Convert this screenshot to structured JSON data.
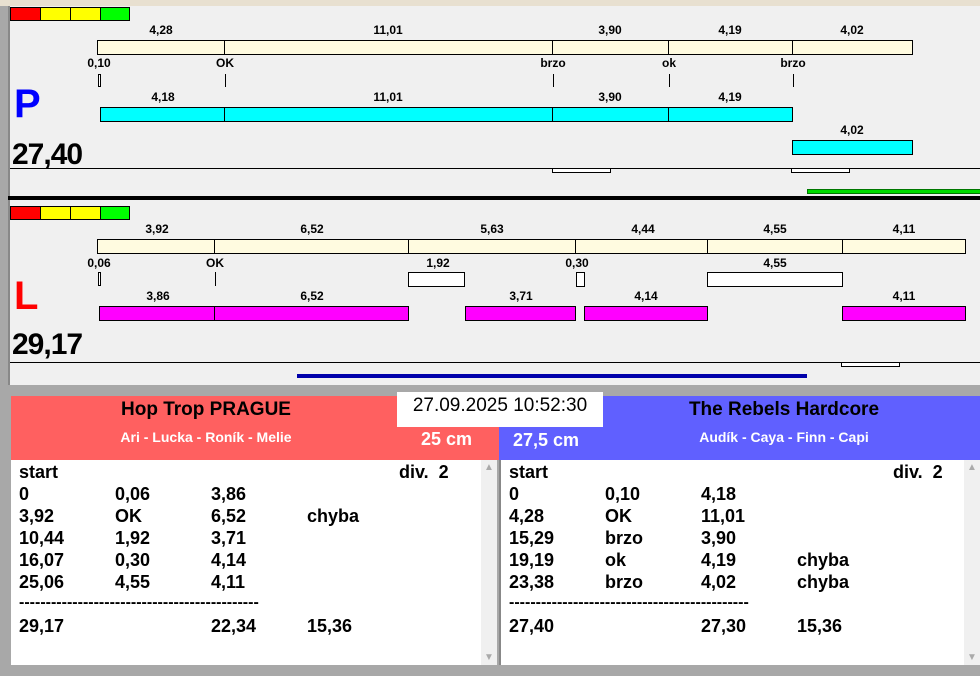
{
  "colors": {
    "traffic": [
      "#ff0000",
      "#ffff00",
      "#ffff00",
      "#00ff00"
    ],
    "left_team": "#ff6060",
    "right_team": "#6060ff"
  },
  "P": {
    "letter": "P",
    "total": "27,40",
    "row1": [
      "4,28",
      "11,01",
      "3,90",
      "4,19",
      "4,02"
    ],
    "markers": [
      "0,10",
      "OK",
      "brzo",
      "ok",
      "brzo"
    ],
    "row2": [
      "4,18",
      "11,01",
      "3,90",
      "4,19"
    ],
    "row3": [
      "4,02"
    ]
  },
  "L": {
    "letter": "L",
    "total": "29,17",
    "row1": [
      "3,92",
      "6,52",
      "5,63",
      "4,44",
      "4,55",
      "4,11"
    ],
    "markers": [
      "0,06",
      "OK",
      "1,92",
      "0,30",
      "4,55"
    ],
    "row2": [
      "3,86",
      "6,52",
      "3,71",
      "4,14",
      "4,11"
    ]
  },
  "datetime": "27.09.2025 10:52:30",
  "left_team": {
    "name": "Hop Trop PRAGUE",
    "members": "Ari - Lucka - Roník - Melie",
    "height": "25 cm",
    "start": "start",
    "division": "div.  2",
    "rows": [
      [
        "0",
        "0,06",
        "3,86",
        ""
      ],
      [
        "3,92",
        "OK",
        "6,52",
        "chyba"
      ],
      [
        "10,44",
        "1,92",
        "3,71",
        ""
      ],
      [
        "16,07",
        "0,30",
        "4,14",
        ""
      ],
      [
        "25,06",
        "4,55",
        "4,11",
        ""
      ]
    ],
    "separator": "---------------------------------------------",
    "totals": [
      "29,17",
      "",
      "22,34",
      "15,36"
    ]
  },
  "right_team": {
    "name": "The Rebels Hardcore",
    "members": "Audík - Caya - Finn - Capi",
    "height": "27,5 cm",
    "start": "start",
    "division": "div.  2",
    "rows": [
      [
        "0",
        "0,10",
        "4,18",
        ""
      ],
      [
        "4,28",
        "OK",
        "11,01",
        ""
      ],
      [
        "15,29",
        "brzo",
        "3,90",
        ""
      ],
      [
        "19,19",
        "ok",
        "4,19",
        "chyba"
      ],
      [
        "23,38",
        "brzo",
        "4,02",
        "chyba"
      ]
    ],
    "separator": "---------------------------------------------",
    "totals": [
      "27,40",
      "",
      "27,30",
      "15,36"
    ]
  }
}
